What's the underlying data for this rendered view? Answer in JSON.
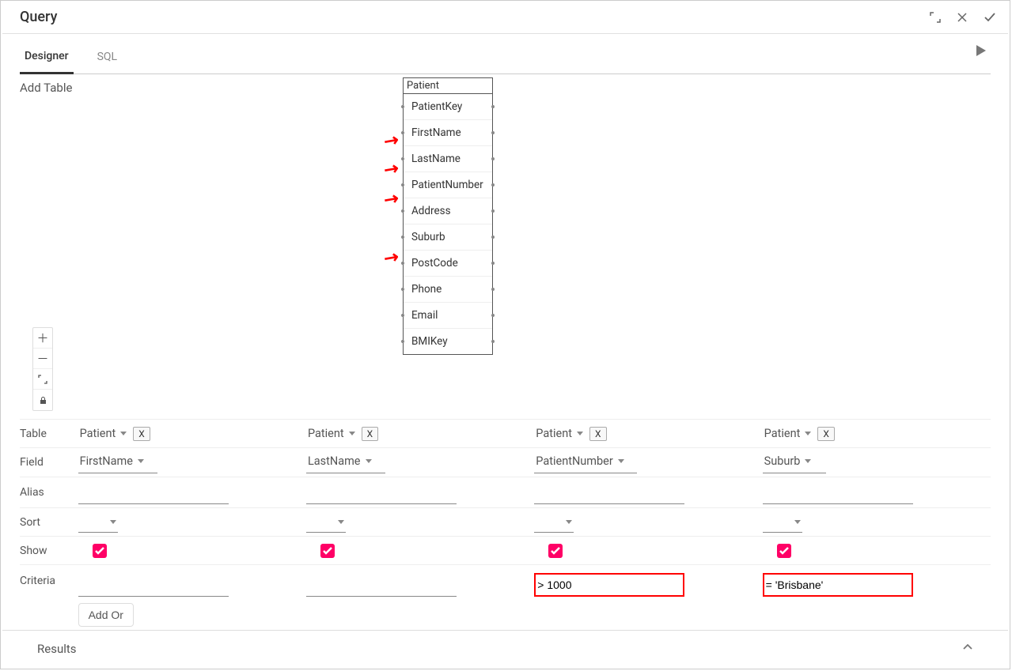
{
  "titlebar": {
    "title": "Query"
  },
  "tabs": {
    "designer": "Designer",
    "sql": "SQL"
  },
  "designer": {
    "add_table": "Add Table",
    "table": {
      "name": "Patient",
      "fields": [
        "PatientKey",
        "FirstName",
        "LastName",
        "PatientNumber",
        "Address",
        "Suburb",
        "PostCode",
        "Phone",
        "Email",
        "BMIKey"
      ]
    }
  },
  "grid": {
    "rows": {
      "table": "Table",
      "field": "Field",
      "alias": "Alias",
      "sort": "Sort",
      "show": "Show",
      "criteria": "Criteria"
    },
    "remove_btn": "X",
    "columns": [
      {
        "table": "Patient",
        "field": "FirstName",
        "alias": "",
        "sort": "",
        "show": true,
        "criteria": ""
      },
      {
        "table": "Patient",
        "field": "LastName",
        "alias": "",
        "sort": "",
        "show": true,
        "criteria": ""
      },
      {
        "table": "Patient",
        "field": "PatientNumber",
        "alias": "",
        "sort": "",
        "show": true,
        "criteria": "> 1000"
      },
      {
        "table": "Patient",
        "field": "Suburb",
        "alias": "",
        "sort": "",
        "show": true,
        "criteria": "= 'Brisbane'"
      }
    ],
    "add_or": "Add Or"
  },
  "results": {
    "label": "Results"
  }
}
